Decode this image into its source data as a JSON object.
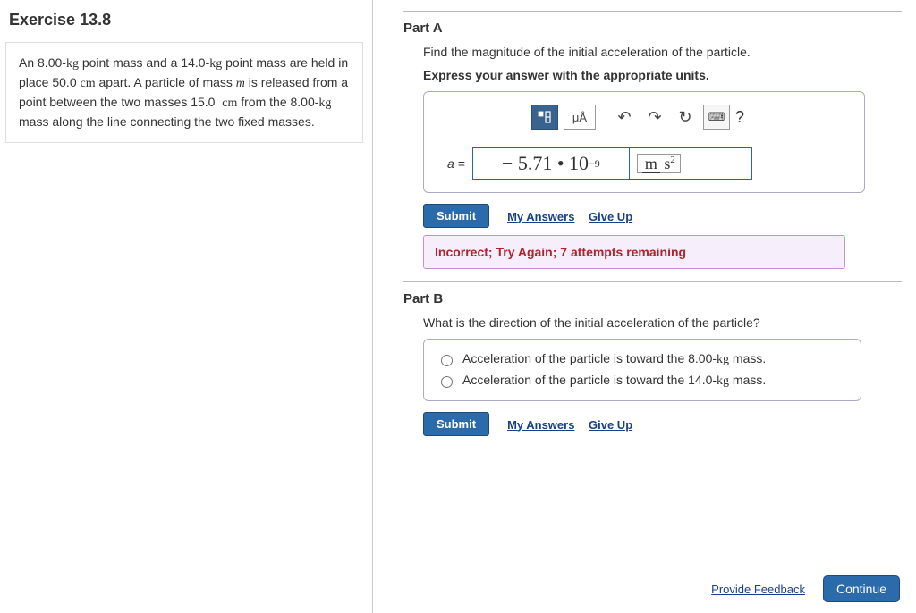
{
  "left": {
    "title": "Exercise 13.8",
    "problem_html": "An 8.00-kg point mass and a 14.0-kg point mass are held in place 50.0 cm apart. A particle of mass m is released from a point between the two masses 15.0  cm from the 8.00-kg mass along the line connecting the two fixed masses."
  },
  "partA": {
    "label": "Part A",
    "instruction": "Find the magnitude of the initial acceleration of the particle.",
    "bold_line": "Express your answer with the appropriate units.",
    "toolbar": {
      "template_icon": "template-icon",
      "muA": "μÅ",
      "undo": "↶",
      "redo": "↷",
      "refresh": "↻",
      "keyboard": "⌨",
      "help": "?"
    },
    "a_eq": "a =",
    "value": "− 5.71 • 10",
    "value_exp": "−9",
    "unit_num": "m",
    "unit_den": "s",
    "unit_den_exp": "2",
    "submit": "Submit",
    "my_answers": "My Answers",
    "give_up": "Give Up",
    "feedback": "Incorrect; Try Again; 7 attempts remaining"
  },
  "partB": {
    "label": "Part B",
    "question": "What is the direction of the initial acceleration of the particle?",
    "options": [
      "Acceleration of the particle is toward the 8.00-kg mass.",
      "Acceleration of the particle is toward the 14.0-kg mass."
    ],
    "submit": "Submit",
    "my_answers": "My Answers",
    "give_up": "Give Up"
  },
  "footer": {
    "provide_feedback": "Provide Feedback",
    "continue": "Continue"
  }
}
